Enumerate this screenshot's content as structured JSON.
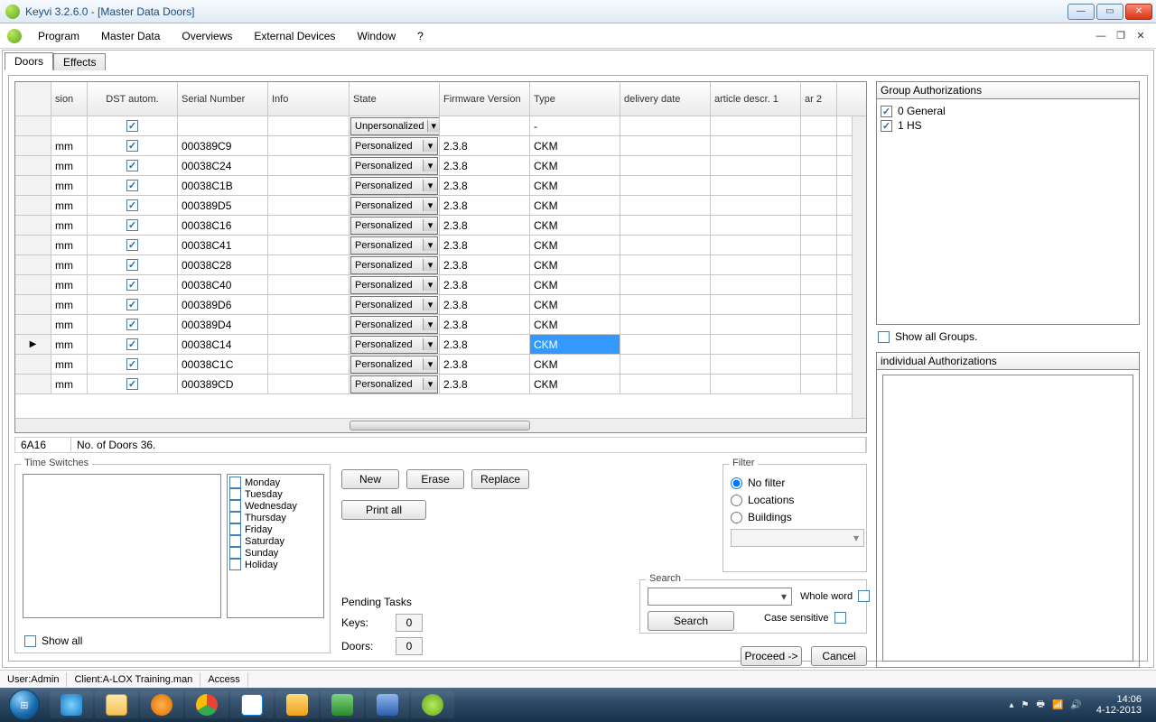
{
  "window": {
    "title": "Keyvi 3.2.6.0 - [Master Data Doors]"
  },
  "menu": [
    "Program",
    "Master Data",
    "Overviews",
    "External Devices",
    "Window",
    "?"
  ],
  "tabs": [
    {
      "label": "Doors",
      "active": true
    },
    {
      "label": "Effects",
      "active": false
    }
  ],
  "grid": {
    "columns": [
      "sion",
      "DST autom.",
      "Serial Number",
      "Info",
      "State",
      "Firmware Version",
      "Type",
      "delivery date",
      "article descr. 1",
      "ar 2"
    ],
    "rows": [
      {
        "sion": "",
        "serial": "",
        "state": "Unpersonalized",
        "fw": "",
        "type": "-",
        "dst": true
      },
      {
        "sion": "mm",
        "serial": "000389C9",
        "state": "Personalized",
        "fw": "2.3.8",
        "type": "CKM",
        "dst": true
      },
      {
        "sion": "mm",
        "serial": "00038C24",
        "state": "Personalized",
        "fw": "2.3.8",
        "type": "CKM",
        "dst": true
      },
      {
        "sion": "mm",
        "serial": "00038C1B",
        "state": "Personalized",
        "fw": "2.3.8",
        "type": "CKM",
        "dst": true
      },
      {
        "sion": "mm",
        "serial": "000389D5",
        "state": "Personalized",
        "fw": "2.3.8",
        "type": "CKM",
        "dst": true
      },
      {
        "sion": "mm",
        "serial": "00038C16",
        "state": "Personalized",
        "fw": "2.3.8",
        "type": "CKM",
        "dst": true
      },
      {
        "sion": "mm",
        "serial": "00038C41",
        "state": "Personalized",
        "fw": "2.3.8",
        "type": "CKM",
        "dst": true
      },
      {
        "sion": "mm",
        "serial": "00038C28",
        "state": "Personalized",
        "fw": "2.3.8",
        "type": "CKM",
        "dst": true
      },
      {
        "sion": "mm",
        "serial": "00038C40",
        "state": "Personalized",
        "fw": "2.3.8",
        "type": "CKM",
        "dst": true
      },
      {
        "sion": "mm",
        "serial": "000389D6",
        "state": "Personalized",
        "fw": "2.3.8",
        "type": "CKM",
        "dst": true
      },
      {
        "sion": "mm",
        "serial": "000389D4",
        "state": "Personalized",
        "fw": "2.3.8",
        "type": "CKM",
        "dst": true
      },
      {
        "sion": "mm",
        "serial": "00038C14",
        "state": "Personalized",
        "fw": "2.3.8",
        "type": "CKM",
        "dst": true,
        "selected": true,
        "current": true
      },
      {
        "sion": "mm",
        "serial": "00038C1C",
        "state": "Personalized",
        "fw": "2.3.8",
        "type": "CKM",
        "dst": true
      },
      {
        "sion": "mm",
        "serial": "000389CD",
        "state": "Personalized",
        "fw": "2.3.8",
        "type": "CKM",
        "dst": true
      }
    ],
    "status_left": "6A16",
    "status_count": "No. of Doors 36."
  },
  "time_switches": {
    "title": "Time Switches",
    "days": [
      "Monday",
      "Tuesday",
      "Wednesday",
      "Thursday",
      "Friday",
      "Saturday",
      "Sunday",
      "Holiday"
    ],
    "show_all": "Show all"
  },
  "buttons": {
    "new": "New",
    "erase": "Erase",
    "replace": "Replace",
    "print_all": "Print all",
    "search": "Search",
    "proceed": "Proceed ->",
    "cancel": "Cancel"
  },
  "pending": {
    "title": "Pending Tasks",
    "keys_label": "Keys:",
    "keys": "0",
    "doors_label": "Doors:",
    "doors": "0"
  },
  "filter": {
    "title": "Filter",
    "no_filter": "No filter",
    "locations": "Locations",
    "buildings": "Buildings"
  },
  "search": {
    "title": "Search",
    "whole": "Whole word",
    "case": "Case sensitive"
  },
  "group_auth": {
    "title": "Group Authorizations",
    "items": [
      {
        "label": "0 General",
        "checked": true
      },
      {
        "label": "1 HS",
        "checked": true
      }
    ],
    "show_all": "Show all Groups."
  },
  "indiv_auth": {
    "title": "individual Authorizations"
  },
  "statusbar": {
    "user": "User:Admin",
    "client": "Client:A-LOX Training.man",
    "access": "Access"
  },
  "taskbar": {
    "time": "14:06",
    "date": "4-12-2013"
  }
}
